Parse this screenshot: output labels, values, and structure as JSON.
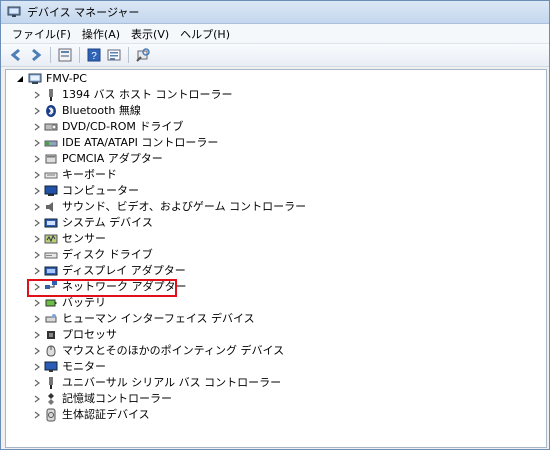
{
  "window": {
    "title": "デバイス マネージャー"
  },
  "menu": {
    "items": [
      "ファイル(F)",
      "操作(A)",
      "表示(V)",
      "ヘルプ(H)"
    ]
  },
  "toolbar": {
    "buttons": [
      "back-icon",
      "forward-icon",
      "properties-icon",
      "help-icon",
      "view-icon",
      "scan-icon"
    ]
  },
  "tree": {
    "root": "FMV-PC",
    "children": [
      {
        "label": "1394 バス ホスト コントローラー",
        "icon": "usb-plug-icon"
      },
      {
        "label": "Bluetooth 無線",
        "icon": "bluetooth-icon"
      },
      {
        "label": "DVD/CD-ROM ドライブ",
        "icon": "dvd-drive-icon"
      },
      {
        "label": "IDE ATA/ATAPI コントローラー",
        "icon": "ide-controller-icon"
      },
      {
        "label": "PCMCIA アダプター",
        "icon": "pcmcia-icon"
      },
      {
        "label": "キーボード",
        "icon": "keyboard-icon"
      },
      {
        "label": "コンピューター",
        "icon": "computer-icon"
      },
      {
        "label": "サウンド、ビデオ、およびゲーム コントローラー",
        "icon": "sound-icon"
      },
      {
        "label": "システム デバイス",
        "icon": "system-devices-icon"
      },
      {
        "label": "センサー",
        "icon": "sensor-icon"
      },
      {
        "label": "ディスク ドライブ",
        "icon": "disk-drive-icon"
      },
      {
        "label": "ディスプレイ アダプター",
        "icon": "display-adapter-icon"
      },
      {
        "label": "ネットワーク アダプター",
        "icon": "network-adapter-icon"
      },
      {
        "label": "バッテリ",
        "icon": "battery-icon"
      },
      {
        "label": "ヒューマン インターフェイス デバイス",
        "icon": "hid-icon"
      },
      {
        "label": "プロセッサ",
        "icon": "processor-icon"
      },
      {
        "label": "マウスとそのほかのポインティング デバイス",
        "icon": "mouse-icon"
      },
      {
        "label": "モニター",
        "icon": "monitor-icon"
      },
      {
        "label": "ユニバーサル シリアル バス コントローラー",
        "icon": "usb-controller-icon"
      },
      {
        "label": "記憶域コントローラー",
        "icon": "storage-controller-icon"
      },
      {
        "label": "生体認証デバイス",
        "icon": "biometric-icon"
      }
    ]
  },
  "colors": {
    "highlight": "#e0101a",
    "selection_blue": "#3399ff"
  }
}
